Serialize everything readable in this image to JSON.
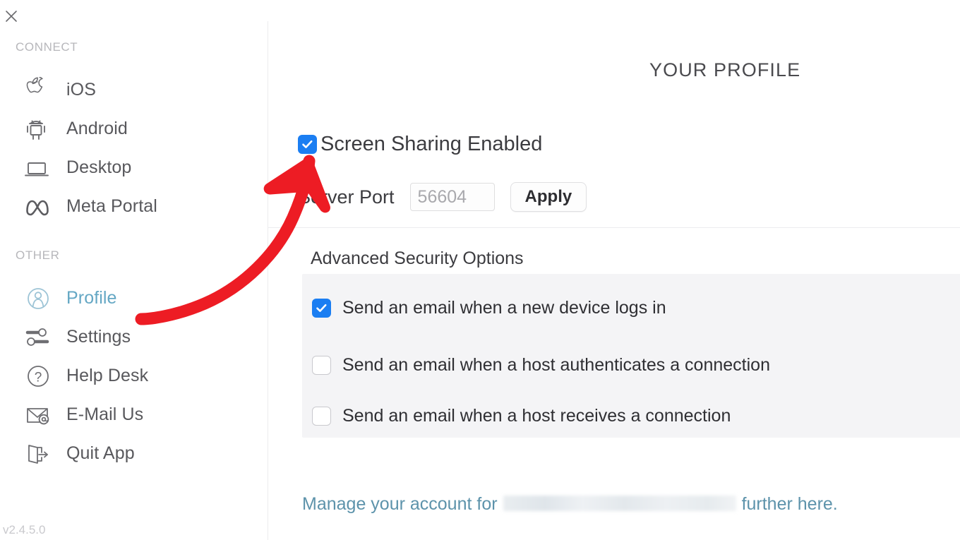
{
  "app": {
    "version": "v2.4.5.0",
    "close_icon": "close-icon"
  },
  "sidebar": {
    "sections": [
      {
        "label": "CONNECT",
        "items": [
          {
            "label": "iOS",
            "icon": "apple-icon"
          },
          {
            "label": "Android",
            "icon": "android-icon"
          },
          {
            "label": "Desktop",
            "icon": "laptop-icon"
          },
          {
            "label": "Meta Portal",
            "icon": "meta-icon"
          }
        ]
      },
      {
        "label": "OTHER",
        "items": [
          {
            "label": "Profile",
            "icon": "person-circle-icon",
            "active": true
          },
          {
            "label": "Settings",
            "icon": "sliders-icon",
            "active": false
          },
          {
            "label": "Help Desk",
            "icon": "question-circle-icon",
            "active": false
          },
          {
            "label": "E-Mail Us",
            "icon": "envelope-at-icon",
            "active": false
          },
          {
            "label": "Quit App",
            "icon": "exit-door-icon",
            "active": false
          }
        ]
      }
    ]
  },
  "main": {
    "title": "YOUR PROFILE",
    "screen_sharing": {
      "label": "Screen Sharing Enabled",
      "checked": true
    },
    "server_port": {
      "label": "Server Port",
      "value": "",
      "placeholder": "56604",
      "apply_label": "Apply"
    },
    "advanced": {
      "title": "Advanced Security Options",
      "options": [
        {
          "label": "Send an email when a new device logs in",
          "checked": true
        },
        {
          "label": "Send an email when a host authenticates a connection",
          "checked": false
        },
        {
          "label": "Send an email when a host receives a connection",
          "checked": false
        }
      ]
    },
    "account_link": {
      "prefix": "Manage your account for",
      "redacted": "",
      "suffix": "further here."
    }
  },
  "annotation": {
    "arrow_color": "#ed1c24",
    "target": "screen-sharing-checkbox"
  },
  "colors": {
    "accent_blue": "#1b7ef2",
    "profile_blue": "#64a7c4",
    "link_blue": "#5d93ab",
    "panel_gray": "#f4f4f6",
    "text_gray": "#58585c",
    "muted_gray": "#b7b7bb"
  }
}
